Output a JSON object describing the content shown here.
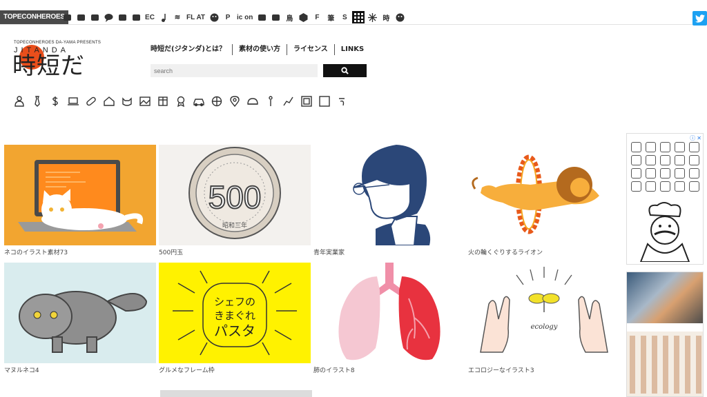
{
  "topbar": {
    "brand": "TOPECONHEROES",
    "site_icons": [
      {
        "name": "animal-icon"
      },
      {
        "name": "copy-icon"
      },
      {
        "name": "person-icon"
      },
      {
        "name": "speech-bubble-icon"
      },
      {
        "name": "bookmark-icon"
      },
      {
        "name": "flower-icon"
      },
      {
        "name": "ec-site",
        "label": "EC"
      },
      {
        "name": "music-note-icon"
      },
      {
        "name": "line-site",
        "label": "≋"
      },
      {
        "name": "flat-site",
        "label": "FL AT"
      },
      {
        "name": "smiley-icon"
      },
      {
        "name": "p-site",
        "label": "P"
      },
      {
        "name": "icon-site",
        "label": "ic on"
      },
      {
        "name": "building-icon"
      },
      {
        "name": "bed-icon"
      },
      {
        "name": "bird-site",
        "label": "鳥"
      },
      {
        "name": "hexagon-icon"
      },
      {
        "name": "f-site",
        "label": "F"
      },
      {
        "name": "brush-site",
        "label": "筆"
      },
      {
        "name": "s-site",
        "label": "S"
      },
      {
        "name": "grid-icon"
      },
      {
        "name": "burst-icon"
      },
      {
        "name": "time-site",
        "label": "時"
      },
      {
        "name": "face-icon"
      }
    ],
    "twitter": "twitter-icon"
  },
  "logo": {
    "tagline": "TOPECONHEROES DA-YAMA PRESENTS",
    "roman": "JITANDA",
    "japanese": "時短だ"
  },
  "nav": {
    "items": [
      "時短だ(ジタンダ)とは？",
      "素材の使い方",
      "ライセンス",
      "LINKS"
    ]
  },
  "search": {
    "placeholder": "search"
  },
  "categories": [
    "person-icon",
    "necktie-icon",
    "dollar-icon",
    "laptop-icon",
    "pill-icon",
    "house-icon",
    "cat-icon",
    "picture-icon",
    "calendar-icon",
    "medal-icon",
    "car-icon",
    "ball-icon",
    "map-pin-icon",
    "helmet-icon",
    "figure-icon",
    "graph-icon",
    "frame-icon",
    "square-icon",
    "wave-icon"
  ],
  "cards": [
    {
      "caption": "ネコのイラスト素材73",
      "bg": "#f2a530"
    },
    {
      "caption": "500円玉",
      "bg": "#f3f1ee",
      "coin_text": "500",
      "coin_sub": "昭和三年"
    },
    {
      "caption": "青年実業家",
      "bg": "#ffffff"
    },
    {
      "caption": "火の輪くぐりするライオン",
      "bg": "#ffffff"
    },
    {
      "caption": "マヌルネコ4",
      "bg": "#d9ecee"
    },
    {
      "caption": "グルメなフレーム枠",
      "bg": "#fff200",
      "frame_text_1": "シェフの",
      "frame_text_2": "きまぐれ",
      "frame_text_3": "パスタ"
    },
    {
      "caption": "肺のイラスト8",
      "bg": "#ffffff"
    },
    {
      "caption": "エコロジーなイラスト3",
      "bg": "#ffffff",
      "eco_text": "ecology"
    }
  ],
  "ads": {
    "mark": "ⓘ ✕"
  }
}
